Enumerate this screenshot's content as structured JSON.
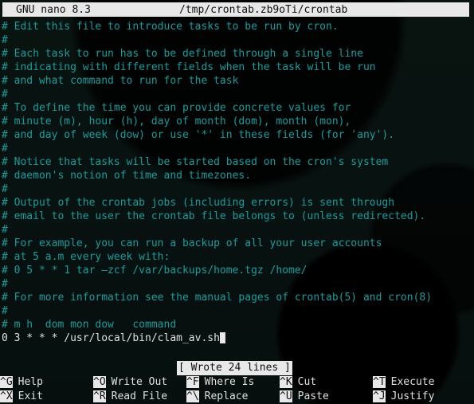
{
  "titlebar": {
    "app": "GNU nano 8.3",
    "filename": "/tmp/crontab.zb9oTi/crontab"
  },
  "editor": {
    "lines": [
      {
        "text": "# Edit this file to introduce tasks to be run by cron.",
        "type": "comment"
      },
      {
        "text": "#",
        "type": "comment"
      },
      {
        "text": "# Each task to run has to be defined through a single line",
        "type": "comment"
      },
      {
        "text": "# indicating with different fields when the task will be run",
        "type": "comment"
      },
      {
        "text": "# and what command to run for the task",
        "type": "comment"
      },
      {
        "text": "#",
        "type": "comment"
      },
      {
        "text": "# To define the time you can provide concrete values for",
        "type": "comment"
      },
      {
        "text": "# minute (m), hour (h), day of month (dom), month (mon),",
        "type": "comment"
      },
      {
        "text": "# and day of week (dow) or use '*' in these fields (for 'any').",
        "type": "comment"
      },
      {
        "text": "#",
        "type": "comment"
      },
      {
        "text": "# Notice that tasks will be started based on the cron's system",
        "type": "comment"
      },
      {
        "text": "# daemon's notion of time and timezones.",
        "type": "comment"
      },
      {
        "text": "#",
        "type": "comment"
      },
      {
        "text": "# Output of the crontab jobs (including errors) is sent through",
        "type": "comment"
      },
      {
        "text": "# email to the user the crontab file belongs to (unless redirected).",
        "type": "comment"
      },
      {
        "text": "#",
        "type": "comment"
      },
      {
        "text": "# For example, you can run a backup of all your user accounts",
        "type": "comment"
      },
      {
        "text": "# at 5 a.m every week with:",
        "type": "comment"
      },
      {
        "text": "# 0 5 * * 1 tar –zcf /var/backups/home.tgz /home/",
        "type": "comment"
      },
      {
        "text": "#",
        "type": "comment"
      },
      {
        "text": "# For more information see the manual pages of crontab(5) and cron(8)",
        "type": "comment"
      },
      {
        "text": "#",
        "type": "comment"
      },
      {
        "text": "# m h  dom mon dow   command",
        "type": "comment"
      },
      {
        "text": "0 3 * * * /usr/local/bin/clam_av.sh",
        "type": "plain",
        "cursor": true
      }
    ]
  },
  "status": {
    "message": "[ Wrote 24 lines ]"
  },
  "helpbar": {
    "row1": [
      {
        "key": "^G",
        "label": "Help",
        "name": "help"
      },
      {
        "key": "^O",
        "label": "Write Out",
        "name": "write-out"
      },
      {
        "key": "^F",
        "label": "Where Is",
        "name": "where-is"
      },
      {
        "key": "^K",
        "label": "Cut",
        "name": "cut"
      },
      {
        "key": "^T",
        "label": "Execute",
        "name": "execute"
      }
    ],
    "row2": [
      {
        "key": "^X",
        "label": "Exit",
        "name": "exit"
      },
      {
        "key": "^R",
        "label": "Read File",
        "name": "read-file"
      },
      {
        "key": "^\\",
        "label": "Replace",
        "name": "replace"
      },
      {
        "key": "^U",
        "label": "Paste",
        "name": "paste"
      },
      {
        "key": "^J",
        "label": "Justify",
        "name": "justify"
      }
    ]
  },
  "colors": {
    "background": "#060f0d",
    "comment_text": "#1a9c9c",
    "plain_text": "#e0e0e0",
    "inverse_bg": "#e8e8e8",
    "inverse_fg": "#101010"
  }
}
